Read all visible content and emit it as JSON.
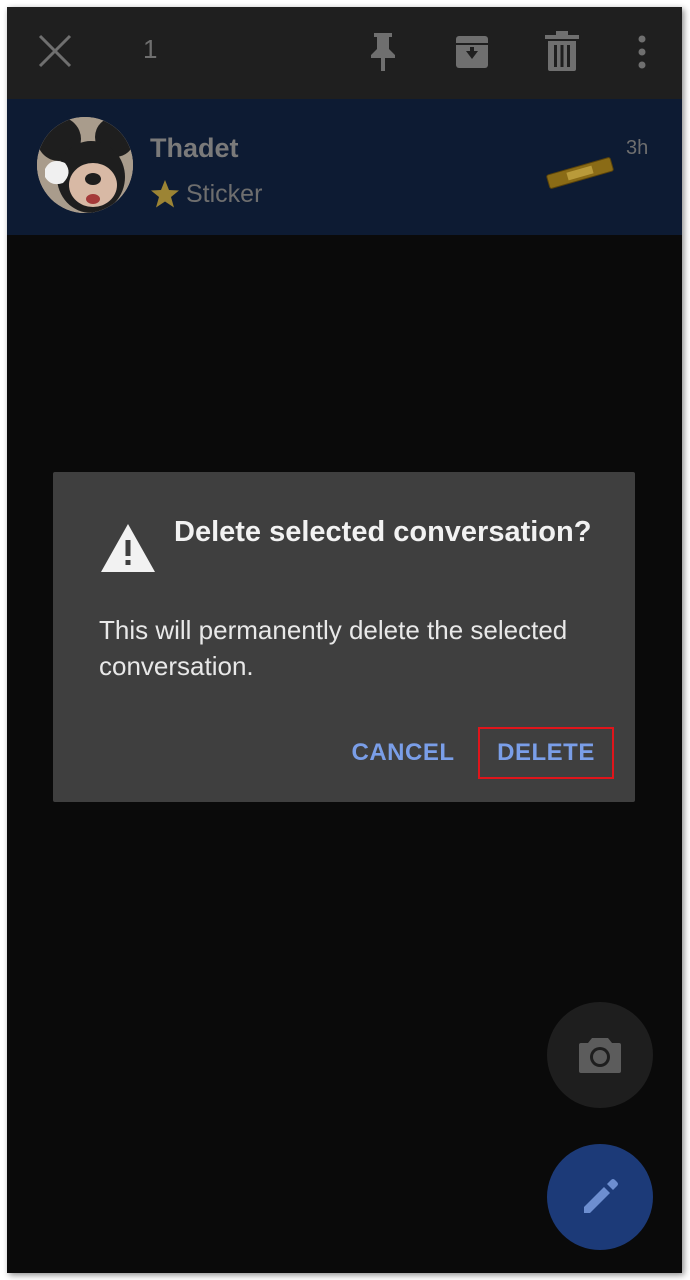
{
  "toolbar": {
    "selected_count": "1",
    "icons": [
      "close-icon",
      "pin-icon",
      "archive-icon",
      "trash-icon",
      "more-vert-icon"
    ]
  },
  "conversation": {
    "name": "Thadet",
    "snippet": "Sticker",
    "snippet_icon": "star-icon",
    "time": "3h"
  },
  "dialog": {
    "title": "Delete selected conversation?",
    "body": "This will permanently delete the selected conversation.",
    "cancel_label": "CANCEL",
    "delete_label": "DELETE",
    "icon": "warning-icon"
  },
  "fabs": [
    "camera-icon",
    "pencil-icon"
  ],
  "colors": {
    "accent_button_text": "#7a9ee8",
    "highlight_outline": "#e0151b",
    "selected_row": "#0d1b33",
    "compose_fab": "#1c3a78"
  }
}
